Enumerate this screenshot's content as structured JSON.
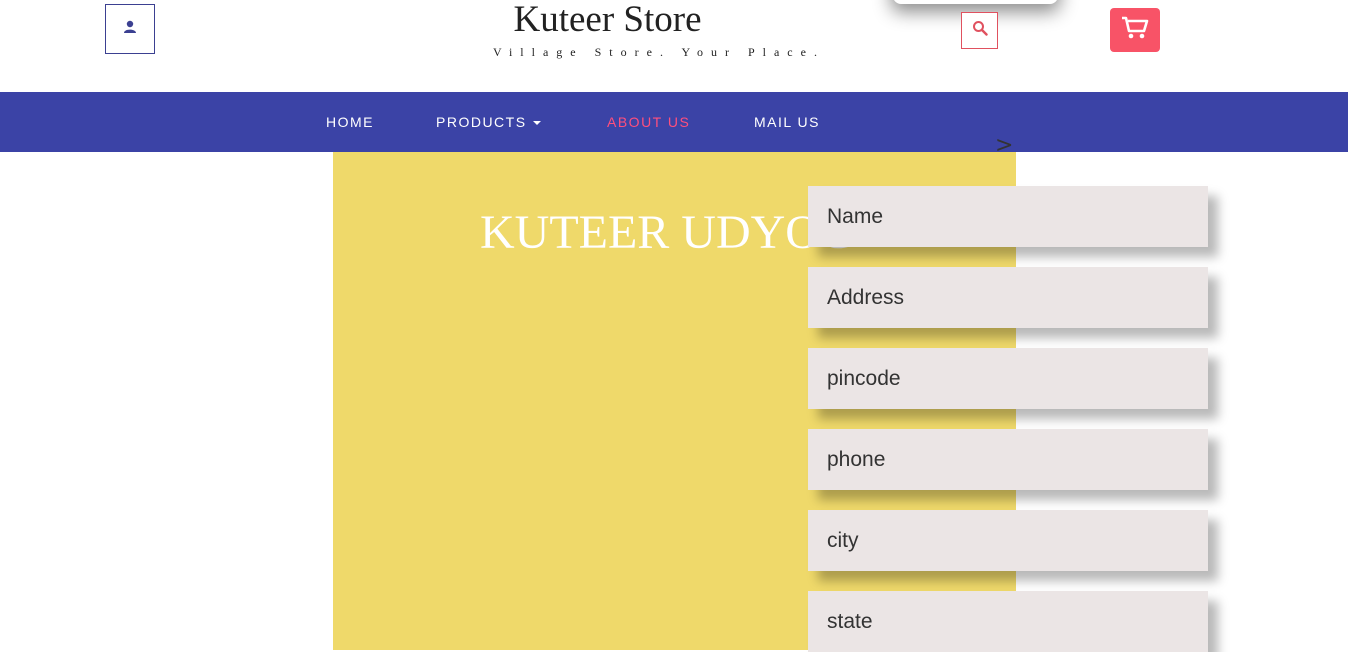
{
  "header": {
    "brand_title": "Kuteer Store",
    "brand_tagline": "Village Store. Your Place.",
    "user_icon": "user-icon",
    "search_icon": "search-icon",
    "cart_icon": "cart-icon"
  },
  "nav": {
    "items": [
      {
        "label": "HOME"
      },
      {
        "label": "PRODUCTS"
      },
      {
        "label": "ABOUT US"
      },
      {
        "label": "MAIL US"
      }
    ],
    "active": "ABOUT US",
    "arrow": ">"
  },
  "panel": {
    "heading": "KUTEER UDYOG"
  },
  "form": {
    "name_placeholder": "Name",
    "address_placeholder": "Address",
    "pincode_placeholder": "pincode",
    "phone_placeholder": "phone",
    "city_placeholder": "city",
    "state_placeholder": "state"
  },
  "colors": {
    "nav_bg": "#3b43a6",
    "active_link": "#ff4f7d",
    "cart_bg": "#f85367",
    "panel_bg": "#efd96a",
    "field_bg": "#ebe5e5"
  }
}
